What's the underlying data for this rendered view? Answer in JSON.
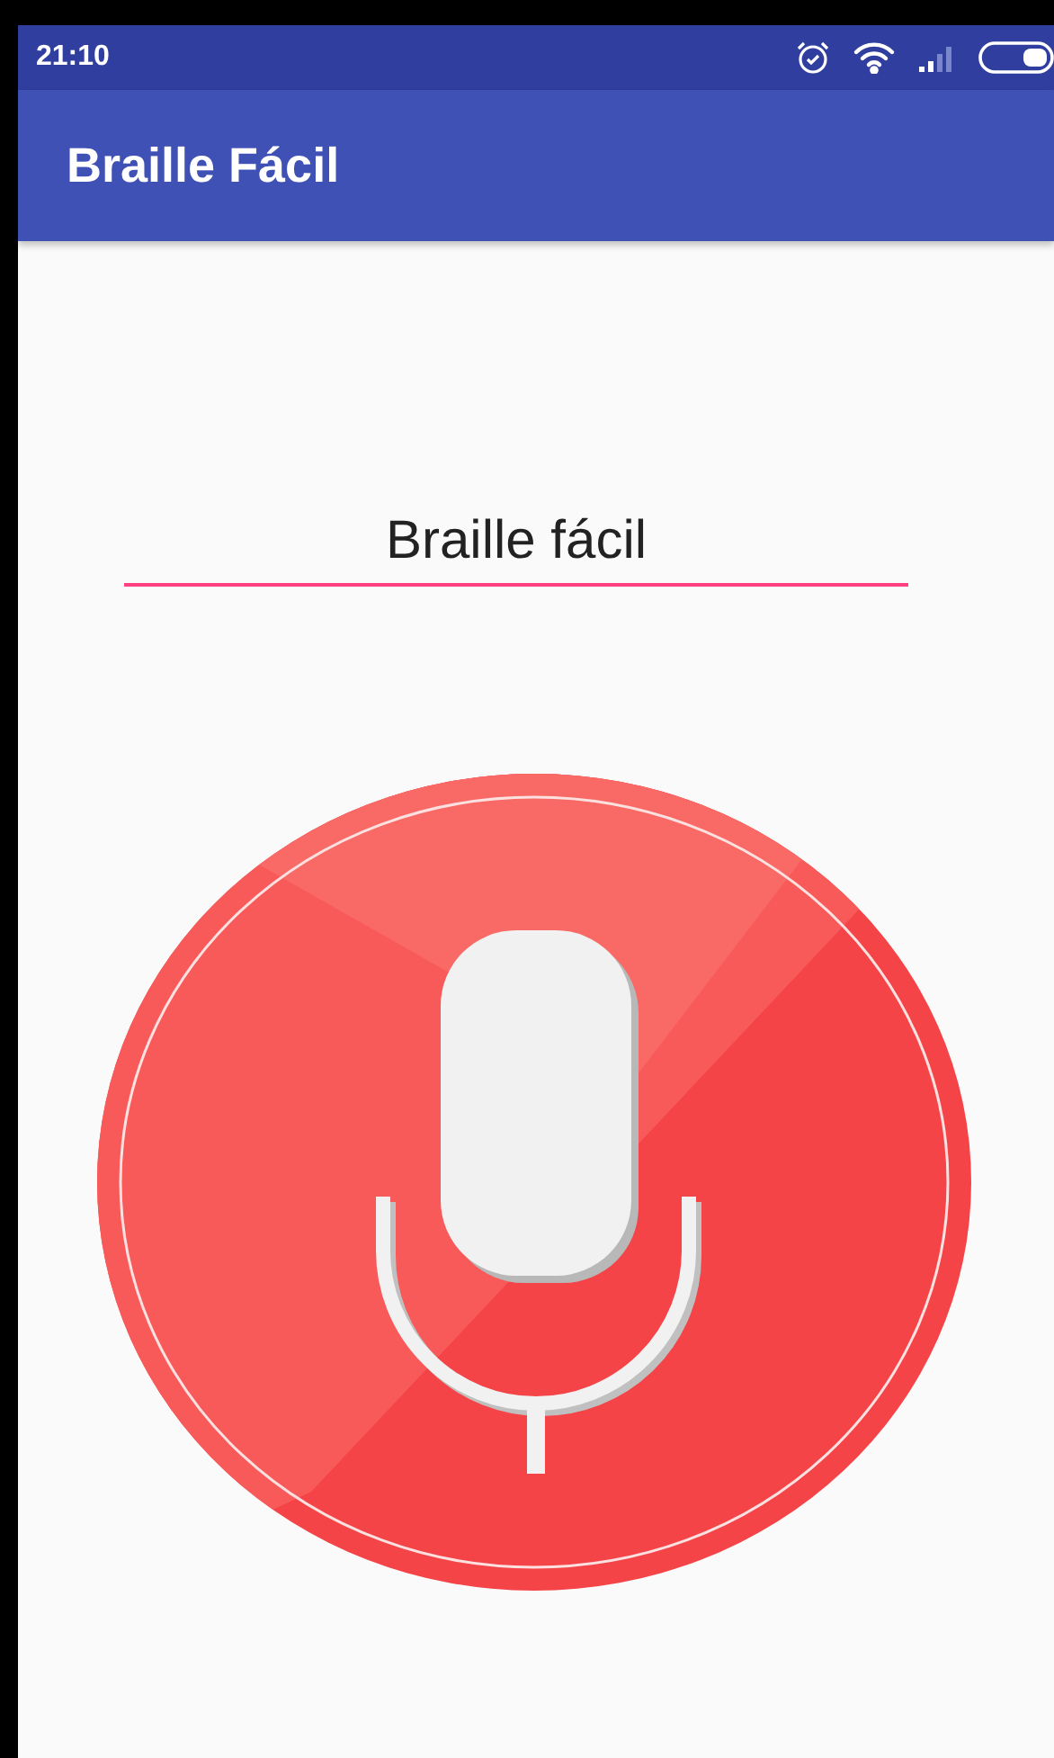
{
  "status_bar": {
    "time": "21:10"
  },
  "app_bar": {
    "title": "Braille Fácil"
  },
  "text_field": {
    "value": "Braille fácil"
  }
}
